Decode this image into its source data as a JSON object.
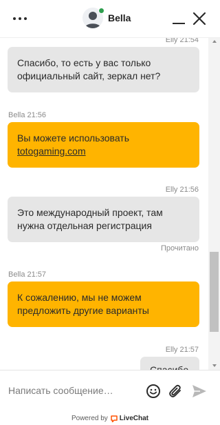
{
  "header": {
    "agent_name": "Bella",
    "status_color": "#2e9e4e",
    "menu_icon": "more-horizontal-icon",
    "minimize_icon": "minimize-icon",
    "close_icon": "close-icon"
  },
  "messages": [
    {
      "author": "Elly",
      "time": "21:54",
      "meta": "Elly 21:54",
      "type": "visitor",
      "text": "Спасибо, то есть у вас только официальный сайт, зеркал нет?"
    },
    {
      "author": "Bella",
      "time": "21:56",
      "meta": "Bella 21:56",
      "type": "agent",
      "text_prefix": "Вы можете использовать",
      "link": "totogaming.com"
    },
    {
      "author": "Elly",
      "time": "21:56",
      "meta": "Elly 21:56",
      "type": "visitor",
      "text": "Это международный проект, там нужна отдельная регистрация",
      "status": "Прочитано"
    },
    {
      "author": "Bella",
      "time": "21:57",
      "meta": "Bella 21:57",
      "type": "agent",
      "text": "К сожалению, мы не можем предложить другие варианты"
    },
    {
      "author": "Elly",
      "time": "21:57",
      "meta": "Elly 21:57",
      "type": "visitor",
      "text": "Спасибо"
    }
  ],
  "composer": {
    "placeholder": "Написать сообщение…",
    "emoji_icon": "emoji-icon",
    "attach_icon": "paperclip-icon",
    "send_icon": "send-icon"
  },
  "footer": {
    "powered_by": "Powered by",
    "brand": "LiveChat",
    "brand_color": "#ff5100"
  },
  "colors": {
    "agent_bubble": "#ffb400",
    "visitor_bubble": "#e6e6e6"
  }
}
